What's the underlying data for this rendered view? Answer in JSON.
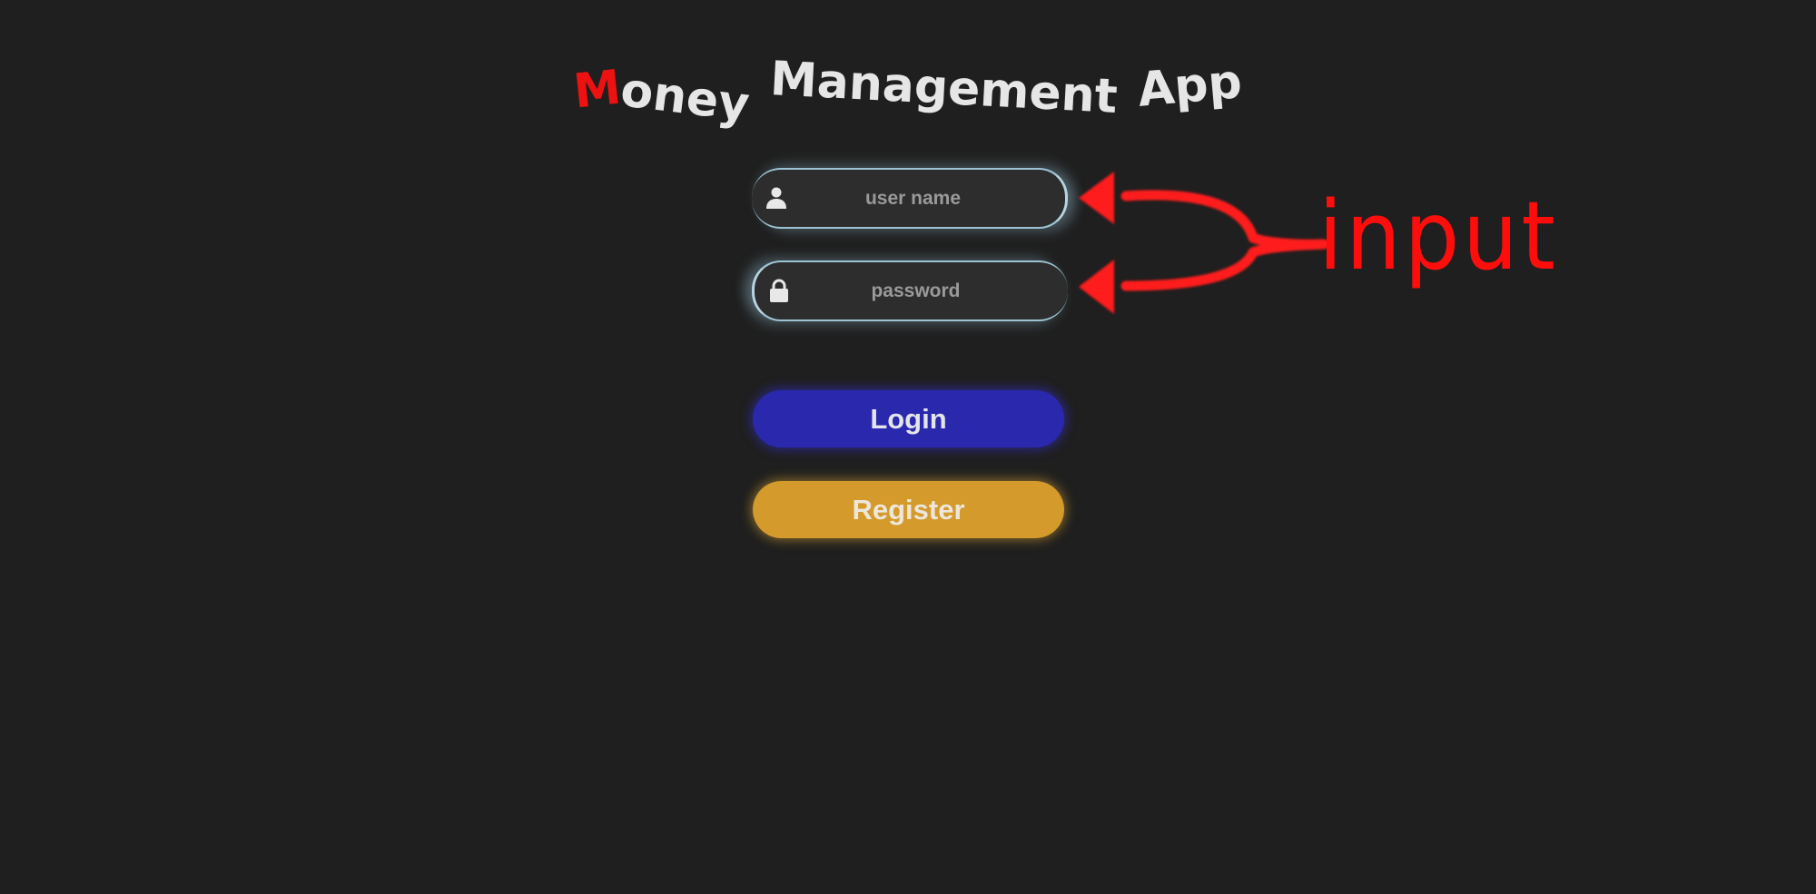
{
  "app": {
    "title_first_letter": "M",
    "title_words": [
      "oney",
      "Management",
      "App"
    ]
  },
  "login_form": {
    "username": {
      "placeholder": "user name",
      "value": "",
      "icon": "user-icon"
    },
    "password": {
      "placeholder": "password",
      "value": "",
      "icon": "lock-icon"
    },
    "login_label": "Login",
    "register_label": "Register"
  },
  "annotation": {
    "label": "input",
    "color": "#ff0d0d"
  },
  "colors": {
    "background": "#1f1f1f",
    "title_accent": "#ee1111",
    "login_button": "#2a29ad",
    "register_button": "#d49a2b",
    "input_glow": "#9cc3d4"
  }
}
